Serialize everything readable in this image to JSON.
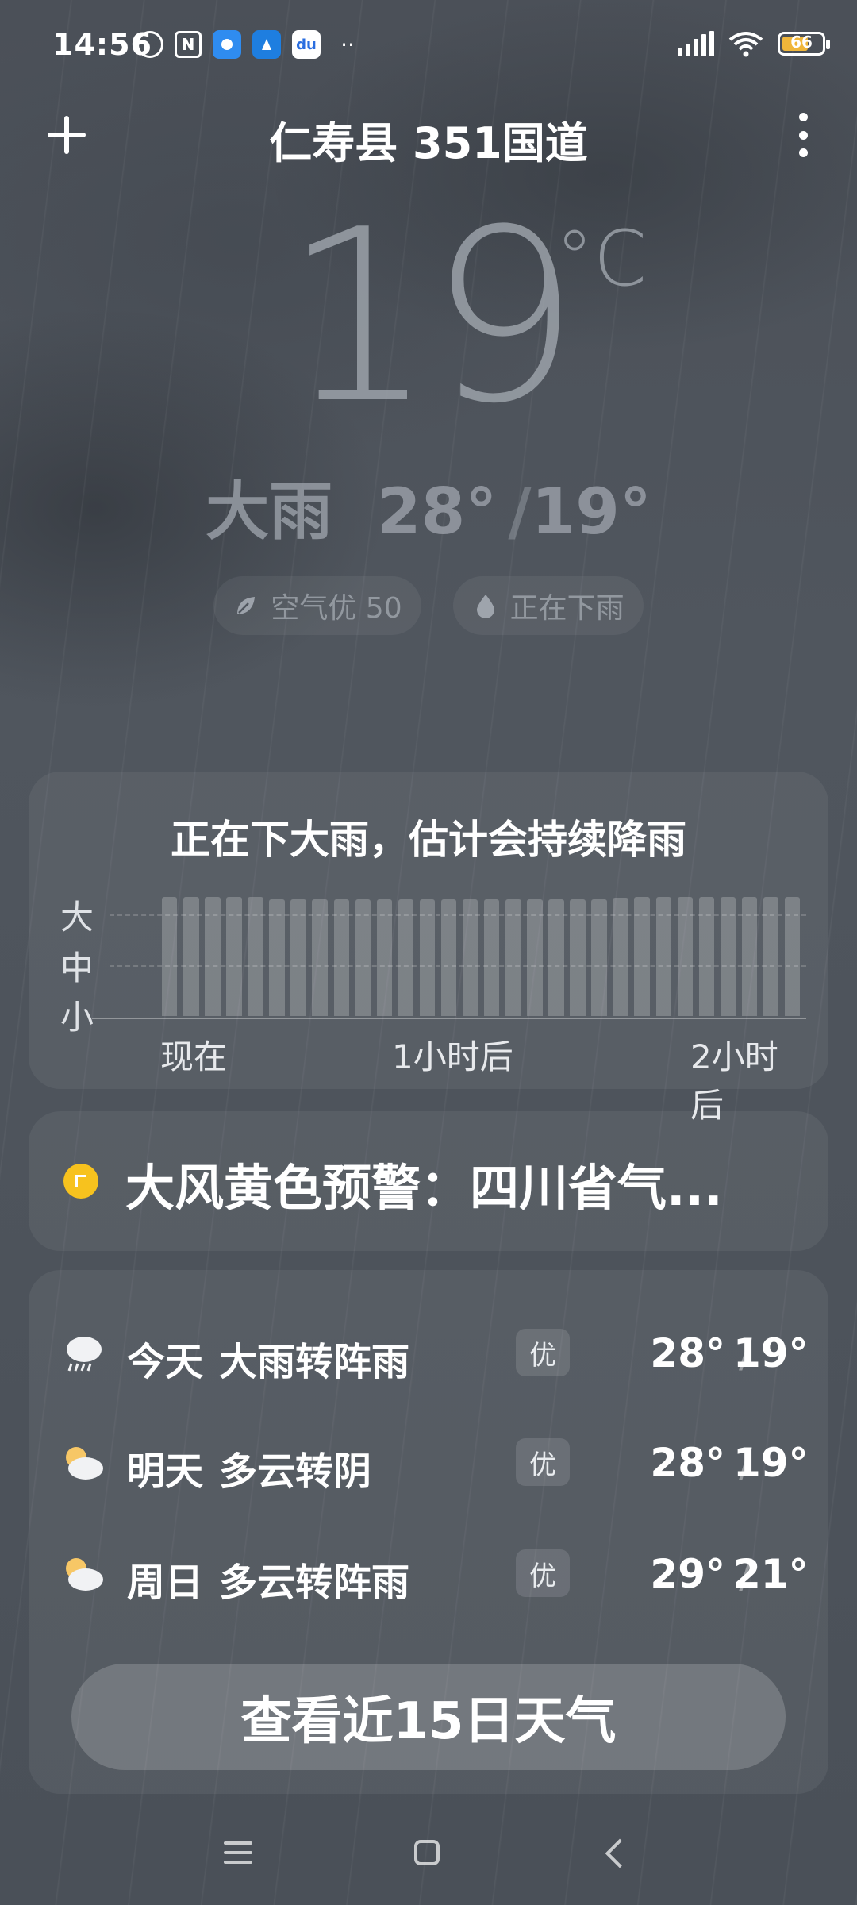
{
  "status_bar": {
    "time": "14:56",
    "battery": "66",
    "notification_icons": [
      "alarm-icon",
      "nfc-icon",
      "app-icon",
      "app-icon",
      "baidu-icon"
    ],
    "accent_colors": {
      "battery_fill": "#f0b63a"
    }
  },
  "header": {
    "location": "仁寿县 351国道",
    "add_icon": "plus-icon",
    "menu_icon": "more-vertical-icon"
  },
  "current": {
    "temperature": "19",
    "unit": "°C",
    "condition": "大雨",
    "high": "28°",
    "low": "19°",
    "air_quality": "空气优 50",
    "precip_status": "正在下雨"
  },
  "rain_forecast": {
    "title": "正在下大雨，估计会持续降雨",
    "y_labels": [
      "大",
      "中",
      "小"
    ],
    "x_labels": [
      "现在",
      "1小时后",
      "2小时后"
    ]
  },
  "chart_data": {
    "type": "bar",
    "title": "正在下大雨，估计会持续降雨",
    "y_categories": [
      "小",
      "中",
      "大"
    ],
    "x_ticks": [
      "现在",
      "1小时后",
      "2小时后"
    ],
    "ylim": [
      0,
      3
    ],
    "values": [
      2.85,
      2.85,
      2.85,
      2.85,
      2.85,
      2.8,
      2.8,
      2.8,
      2.8,
      2.8,
      2.8,
      2.8,
      2.8,
      2.8,
      2.8,
      2.8,
      2.8,
      2.8,
      2.8,
      2.8,
      2.8,
      2.83,
      2.85,
      2.85,
      2.85,
      2.85,
      2.85,
      2.85,
      2.85,
      2.85
    ],
    "grid": true
  },
  "warning": {
    "text": "大风黄色预警：四川省气...",
    "color": "#f7c21e"
  },
  "forecast": [
    {
      "icon": "heavy-rain-icon",
      "day": "今天",
      "desc": "大雨转阵雨",
      "aqi": "优",
      "high": "28°",
      "low": "19°"
    },
    {
      "icon": "partly-cloudy-icon",
      "day": "明天",
      "desc": "多云转阴",
      "aqi": "优",
      "high": "28°",
      "low": "19°"
    },
    {
      "icon": "partly-cloudy-icon",
      "day": "周日",
      "desc": "多云转阵雨",
      "aqi": "优",
      "high": "29°",
      "low": "21°"
    }
  ],
  "cta_label": "查看近15日天气",
  "slash": "/"
}
